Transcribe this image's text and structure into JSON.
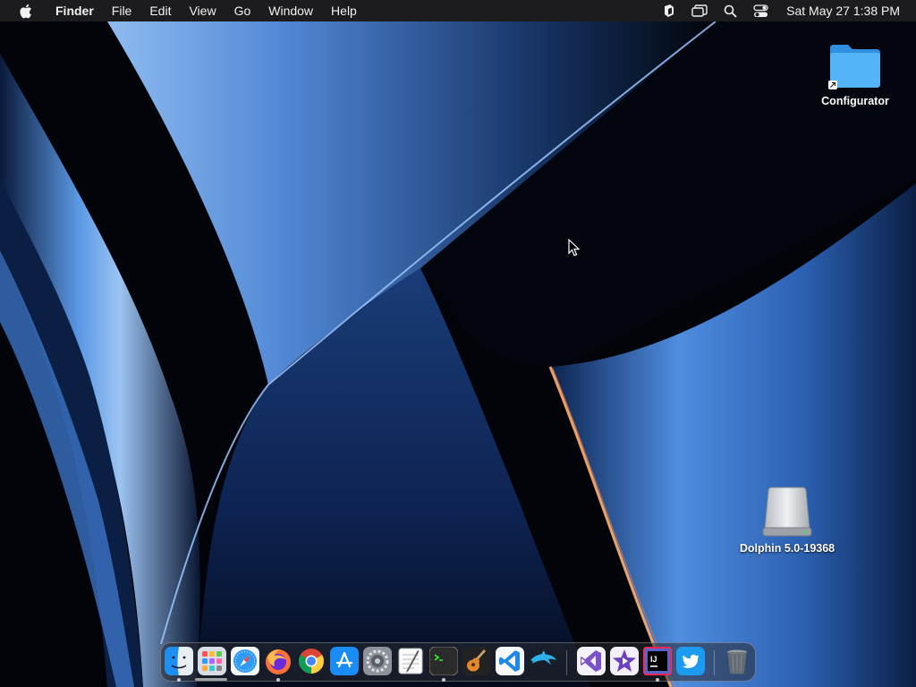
{
  "menubar": {
    "apple_icon": "apple-logo-icon",
    "app_name": "Finder",
    "menus": [
      "File",
      "Edit",
      "View",
      "Go",
      "Window",
      "Help"
    ],
    "status_icons": [
      "app-extension-icon",
      "screen-mirroring-icon",
      "spotlight-search-icon",
      "control-center-icon"
    ],
    "clock": "Sat May 27  1:38 PM"
  },
  "desktop": {
    "icons": [
      {
        "label": "Configurator",
        "icon": "folder-alias-icon"
      },
      {
        "label": "Dolphin 5.0-19368",
        "icon": "disk-image-icon"
      }
    ]
  },
  "dock": {
    "items": [
      {
        "name": "Finder",
        "icon": "finder-icon",
        "running": true
      },
      {
        "name": "Launchpad",
        "icon": "launchpad-icon",
        "running": false
      },
      {
        "name": "Safari",
        "icon": "safari-icon",
        "running": false
      },
      {
        "name": "Firefox",
        "icon": "firefox-icon",
        "running": true
      },
      {
        "name": "Google Chrome",
        "icon": "chrome-icon",
        "running": false
      },
      {
        "name": "App Store",
        "icon": "app-store-icon",
        "running": false
      },
      {
        "name": "System Preferences",
        "icon": "system-preferences-icon",
        "running": false
      },
      {
        "name": "TextEdit",
        "icon": "textedit-icon",
        "running": false
      },
      {
        "name": "Terminal",
        "icon": "terminal-icon",
        "running": true
      },
      {
        "name": "GarageBand",
        "icon": "garageband-icon",
        "running": false
      },
      {
        "name": "Visual Studio Code",
        "icon": "vscode-icon",
        "running": false
      },
      {
        "name": "Dolphin",
        "icon": "dolphin-icon",
        "running": false
      },
      {
        "name": "Visual Studio",
        "icon": "visual-studio-icon",
        "running": false
      },
      {
        "name": "iMovie",
        "icon": "imovie-icon",
        "running": false
      },
      {
        "name": "IntelliJ IDEA",
        "icon": "intellij-icon",
        "running": true
      },
      {
        "name": "Twitter",
        "icon": "twitter-icon",
        "running": false
      },
      {
        "name": "Trash",
        "icon": "trash-icon",
        "running": false
      }
    ]
  },
  "colors": {
    "menubar": "#1e1e22",
    "wallpaper_blue": "#3f7fd6",
    "wallpaper_dark": "#02040a",
    "wallpaper_orange": "#ff9a4a"
  }
}
